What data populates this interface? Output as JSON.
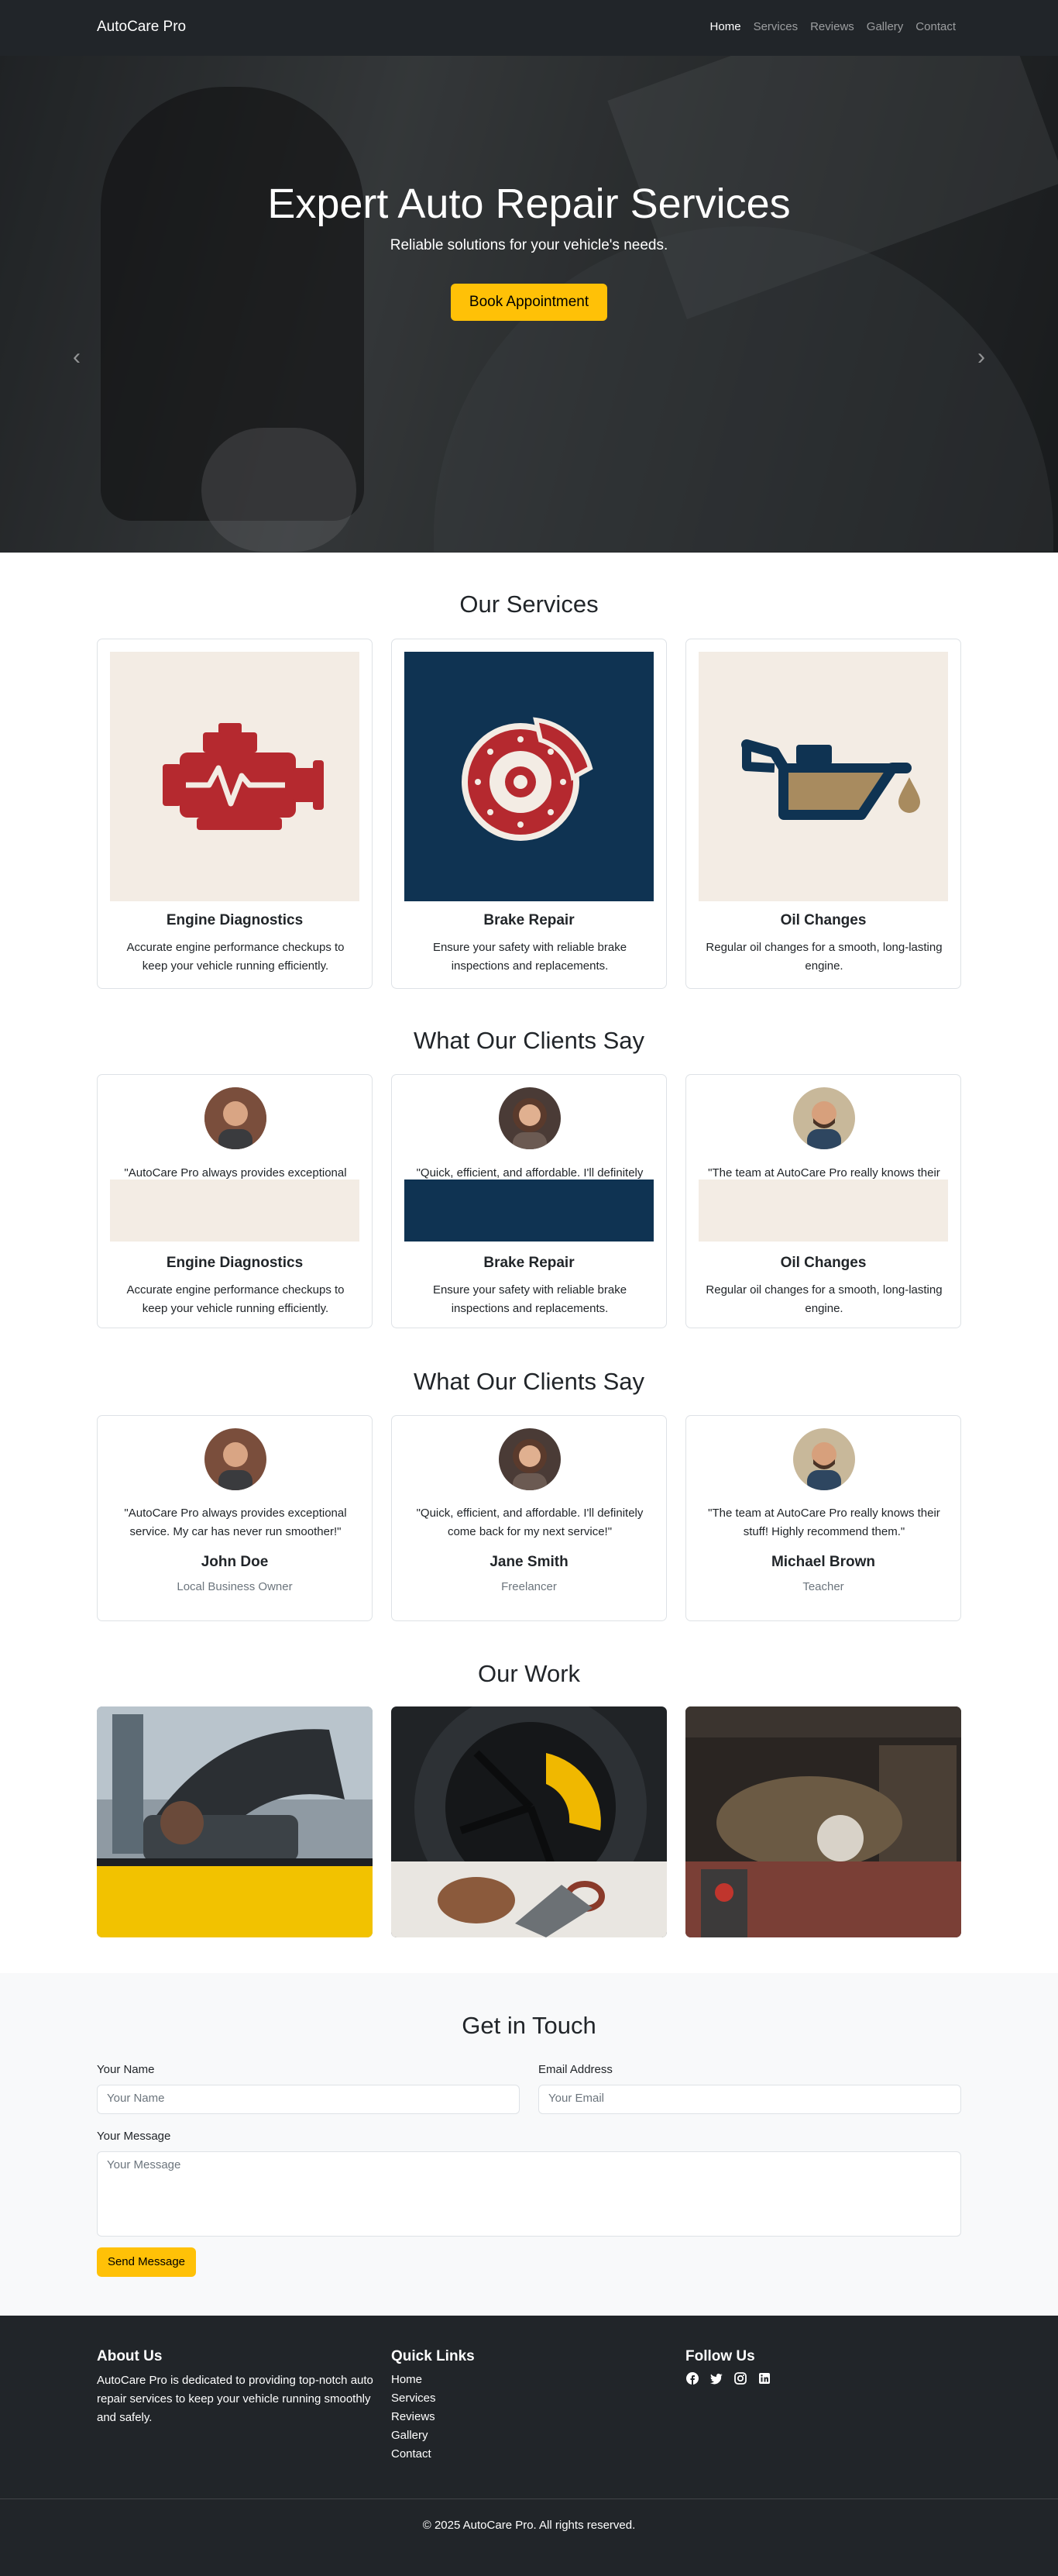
{
  "nav": {
    "brand": "AutoCare Pro",
    "links": [
      "Home",
      "Services",
      "Reviews",
      "Gallery",
      "Contact"
    ]
  },
  "hero": {
    "title": "Expert Auto Repair Services",
    "subtitle": "Reliable solutions for your vehicle's needs.",
    "button": "Book Appointment",
    "prev_icon": "chevron-left-icon",
    "next_icon": "chevron-right-icon"
  },
  "services": {
    "title": "Our Services",
    "items": [
      {
        "title": "Engine Diagnostics",
        "text": "Accurate engine performance checkups to keep your vehicle running efficiently.",
        "icon": "engine-icon",
        "bg": "#f3ece4"
      },
      {
        "title": "Brake Repair",
        "text": "Ensure your safety with reliable brake inspections and replacements.",
        "icon": "brake-disc-icon",
        "bg": "#0f3352"
      },
      {
        "title": "Oil Changes",
        "text": "Regular oil changes for a smooth, long-lasting engine.",
        "icon": "oil-can-icon",
        "bg": "#f3ece4"
      }
    ]
  },
  "reviews_overlap": {
    "title": "What Our Clients Say",
    "quotes_clipped": [
      "\"AutoCare Pro always provides exceptional",
      "\"Quick, efficient, and affordable. I'll definitely",
      "\"The team at AutoCare Pro really knows their"
    ],
    "items": [
      {
        "title": "Engine Diagnostics",
        "text": "Accurate engine performance checkups to keep your vehicle running efficiently."
      },
      {
        "title": "Brake Repair",
        "text": "Ensure your safety with reliable brake inspections and replacements."
      },
      {
        "title": "Oil Changes",
        "text": "Regular oil changes for a smooth, long-lasting engine."
      }
    ]
  },
  "reviews": {
    "title": "What Our Clients Say",
    "items": [
      {
        "quote": "\"AutoCare Pro always provides exceptional service. My car has never run smoother!\"",
        "name": "John Doe",
        "role": "Local Business Owner"
      },
      {
        "quote": "\"Quick, efficient, and affordable. I'll definitely come back for my next service!\"",
        "name": "Jane Smith",
        "role": "Freelancer"
      },
      {
        "quote": "\"The team at AutoCare Pro really knows their stuff! Highly recommend them.\"",
        "name": "Michael Brown",
        "role": "Teacher"
      }
    ]
  },
  "gallery": {
    "title": "Our Work"
  },
  "contact": {
    "title": "Get in Touch",
    "name_label": "Your Name",
    "name_placeholder": "Your Name",
    "email_label": "Email Address",
    "email_placeholder": "Your Email",
    "message_label": "Your Message",
    "message_placeholder": "Your Message",
    "button": "Send Message"
  },
  "footer": {
    "about_title": "About Us",
    "about_text": "AutoCare Pro is dedicated to providing top-notch auto repair services to keep your vehicle running smoothly and safely.",
    "links_title": "Quick Links",
    "links": [
      "Home",
      "Services",
      "Reviews",
      "Gallery",
      "Contact"
    ],
    "follow_title": "Follow Us",
    "social_icons": [
      "facebook-icon",
      "twitter-icon",
      "instagram-icon",
      "linkedin-icon"
    ],
    "copyright": "© 2025 AutoCare Pro. All rights reserved."
  },
  "colors": {
    "accent": "#ffc107",
    "dark": "#212529",
    "navy": "#0f3352",
    "cream": "#f3ece4",
    "red": "#b5292f"
  }
}
